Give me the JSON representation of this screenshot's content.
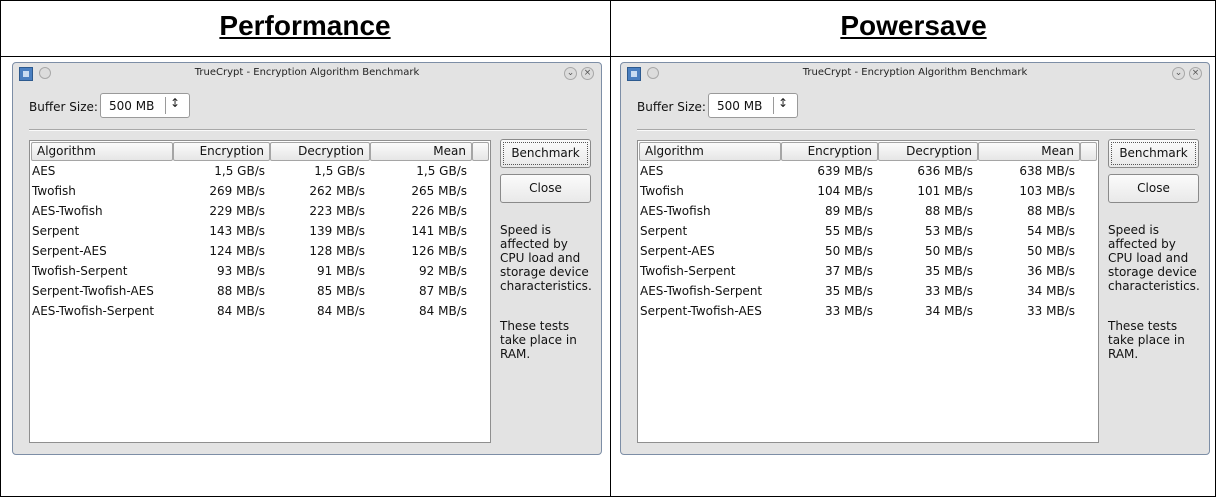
{
  "panels": [
    {
      "heading": "Performance",
      "window_title": "TrueCrypt - Encryption Algorithm Benchmark",
      "buffer_label": "Buffer Size:",
      "buffer_value": "500 MB",
      "columns": [
        "Algorithm",
        "Encryption",
        "Decryption",
        "Mean"
      ],
      "rows": [
        {
          "algorithm": "AES",
          "encryption": "1,5 GB/s",
          "decryption": "1,5 GB/s",
          "mean": "1,5 GB/s"
        },
        {
          "algorithm": "Twofish",
          "encryption": "269 MB/s",
          "decryption": "262 MB/s",
          "mean": "265 MB/s"
        },
        {
          "algorithm": "AES-Twofish",
          "encryption": "229 MB/s",
          "decryption": "223 MB/s",
          "mean": "226 MB/s"
        },
        {
          "algorithm": "Serpent",
          "encryption": "143 MB/s",
          "decryption": "139 MB/s",
          "mean": "141 MB/s"
        },
        {
          "algorithm": "Serpent-AES",
          "encryption": "124 MB/s",
          "decryption": "128 MB/s",
          "mean": "126 MB/s"
        },
        {
          "algorithm": "Twofish-Serpent",
          "encryption": "93 MB/s",
          "decryption": "91 MB/s",
          "mean": "92 MB/s"
        },
        {
          "algorithm": "Serpent-Twofish-AES",
          "encryption": "88 MB/s",
          "decryption": "85 MB/s",
          "mean": "87 MB/s"
        },
        {
          "algorithm": "AES-Twofish-Serpent",
          "encryption": "84 MB/s",
          "decryption": "84 MB/s",
          "mean": "84 MB/s"
        }
      ],
      "benchmark_label": "Benchmark",
      "close_label": "Close",
      "info_speed": "Speed is affected by CPU load and storage device characteristics.",
      "info_ram": "These tests take place in RAM."
    },
    {
      "heading": "Powersave",
      "window_title": "TrueCrypt - Encryption Algorithm Benchmark",
      "buffer_label": "Buffer Size:",
      "buffer_value": "500 MB",
      "columns": [
        "Algorithm",
        "Encryption",
        "Decryption",
        "Mean"
      ],
      "rows": [
        {
          "algorithm": "AES",
          "encryption": "639 MB/s",
          "decryption": "636 MB/s",
          "mean": "638 MB/s"
        },
        {
          "algorithm": "Twofish",
          "encryption": "104 MB/s",
          "decryption": "101 MB/s",
          "mean": "103 MB/s"
        },
        {
          "algorithm": "AES-Twofish",
          "encryption": "89 MB/s",
          "decryption": "88 MB/s",
          "mean": "88 MB/s"
        },
        {
          "algorithm": "Serpent",
          "encryption": "55 MB/s",
          "decryption": "53 MB/s",
          "mean": "54 MB/s"
        },
        {
          "algorithm": "Serpent-AES",
          "encryption": "50 MB/s",
          "decryption": "50 MB/s",
          "mean": "50 MB/s"
        },
        {
          "algorithm": "Twofish-Serpent",
          "encryption": "37 MB/s",
          "decryption": "35 MB/s",
          "mean": "36 MB/s"
        },
        {
          "algorithm": "AES-Twofish-Serpent",
          "encryption": "35 MB/s",
          "decryption": "33 MB/s",
          "mean": "34 MB/s"
        },
        {
          "algorithm": "Serpent-Twofish-AES",
          "encryption": "33 MB/s",
          "decryption": "34 MB/s",
          "mean": "33 MB/s"
        }
      ],
      "benchmark_label": "Benchmark",
      "close_label": "Close",
      "info_speed": "Speed is affected by CPU load and storage device characteristics.",
      "info_ram": "These tests take place in RAM."
    }
  ]
}
